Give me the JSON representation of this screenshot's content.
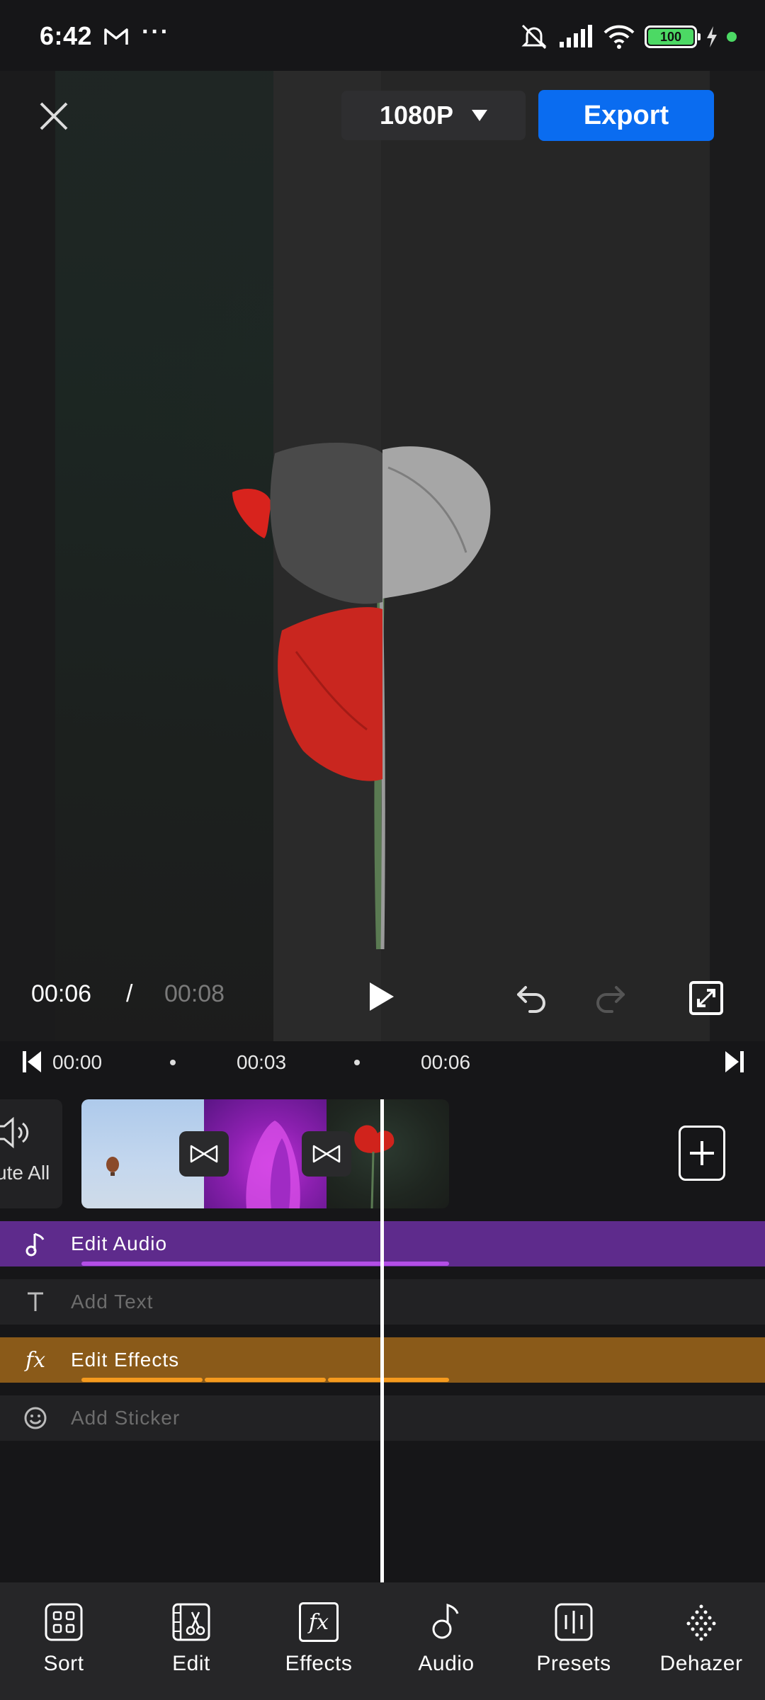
{
  "status_bar": {
    "time": "6:42",
    "battery": "100",
    "icons": [
      "gmail-icon",
      "more-dots-icon",
      "mute-icon",
      "signal-icon",
      "wifi-icon",
      "battery-icon",
      "charging-icon",
      "green-dot"
    ]
  },
  "header": {
    "resolution": "1080P",
    "export_label": "Export"
  },
  "playback": {
    "current_time": "00:06",
    "separator": "/",
    "total_time": "00:08"
  },
  "ruler": {
    "ticks": [
      "00:00",
      "00:03",
      "00:06"
    ]
  },
  "clips": {
    "mute_label": "ute All",
    "items": [
      "hot-air-balloon-clip",
      "purple-flower-clip",
      "red-poppy-clip"
    ]
  },
  "tracks": {
    "audio": "Edit Audio",
    "text": "Add Text",
    "effects": "Edit Effects",
    "sticker": "Add Sticker"
  },
  "bottom_nav": {
    "items": [
      {
        "label": "Sort",
        "icon": "sort-grid-icon"
      },
      {
        "label": "Edit",
        "icon": "edit-scissors-icon"
      },
      {
        "label": "Effects",
        "icon": "effects-fx-icon"
      },
      {
        "label": "Audio",
        "icon": "audio-note-icon"
      },
      {
        "label": "Presets",
        "icon": "presets-icon"
      },
      {
        "label": "Dehazer",
        "icon": "dehazer-icon"
      }
    ]
  },
  "colors": {
    "accent": "#0a6cf0",
    "audio_track": "#5e2b8c",
    "effects_track": "#8a5a19",
    "background": "#161618"
  }
}
